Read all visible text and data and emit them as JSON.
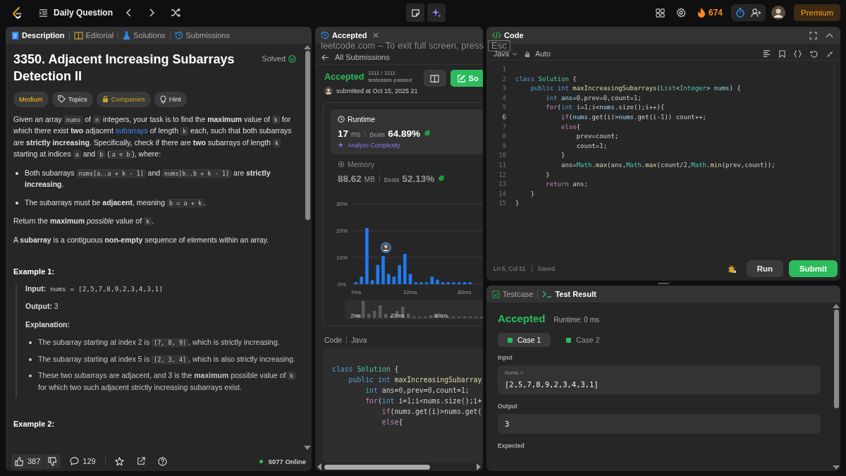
{
  "top_bar": {
    "title": "Daily Question",
    "streak": "674",
    "premium": "Premium"
  },
  "fullscreen_notice": {
    "text": "leetcode.com – To exit full screen, press",
    "key": "Esc"
  },
  "description_panel": {
    "tabs": [
      {
        "label": "Description",
        "selected": true
      },
      {
        "label": "Editorial",
        "selected": false
      },
      {
        "label": "Solutions",
        "selected": false
      },
      {
        "label": "Submissions",
        "selected": false
      }
    ],
    "title": "3350. Adjacent Increasing Subarrays Detection II",
    "status": "Solved",
    "tags": [
      {
        "label": "Medium",
        "kind": "difficulty"
      },
      {
        "label": "Topics",
        "kind": "topics"
      },
      {
        "label": "Companies",
        "kind": "companies"
      },
      {
        "label": "Hint",
        "kind": "hint"
      }
    ],
    "content": [
      {
        "kind": "para",
        "segments": [
          {
            "kind": "t",
            "text": "Given an array "
          },
          {
            "kind": "c",
            "text": "nums"
          },
          {
            "kind": "t",
            "text": " of "
          },
          {
            "kind": "c",
            "text": "n"
          },
          {
            "kind": "t",
            "text": " integers, your task is to find the "
          },
          {
            "kind": "b",
            "text": "maximum"
          },
          {
            "kind": "t",
            "text": " value of "
          },
          {
            "kind": "c",
            "text": "k"
          },
          {
            "kind": "t",
            "text": " for which there exist "
          },
          {
            "kind": "b",
            "text": "two"
          },
          {
            "kind": "t",
            "text": " adjacent "
          },
          {
            "kind": "a",
            "text": "subarrays"
          },
          {
            "kind": "t",
            "text": " of length "
          },
          {
            "kind": "c",
            "text": "k"
          },
          {
            "kind": "t",
            "text": " each, such that both subarrays are "
          },
          {
            "kind": "b",
            "text": "strictly increasing"
          },
          {
            "kind": "t",
            "text": ". Specifically, check if there are "
          },
          {
            "kind": "b",
            "text": "two"
          },
          {
            "kind": "t",
            "text": " subarrays of length "
          },
          {
            "kind": "c",
            "text": "k"
          },
          {
            "kind": "t",
            "text": " starting at indices "
          },
          {
            "kind": "c",
            "text": "a"
          },
          {
            "kind": "t",
            "text": " and "
          },
          {
            "kind": "c",
            "text": "b"
          },
          {
            "kind": "t",
            "text": " ("
          },
          {
            "kind": "c",
            "text": "a < b"
          },
          {
            "kind": "t",
            "text": "), where:"
          }
        ]
      },
      {
        "kind": "bullet",
        "segments": [
          {
            "kind": "t",
            "text": "Both subarrays "
          },
          {
            "kind": "c",
            "text": "nums[a..a + k - 1]"
          },
          {
            "kind": "t",
            "text": " and "
          },
          {
            "kind": "c",
            "text": "nums[b..b + k - 1]"
          },
          {
            "kind": "t",
            "text": " are "
          },
          {
            "kind": "b",
            "text": "strictly increasing"
          },
          {
            "kind": "t",
            "text": "."
          }
        ]
      },
      {
        "kind": "bullet",
        "segments": [
          {
            "kind": "t",
            "text": "The subarrays must be "
          },
          {
            "kind": "b",
            "text": "adjacent"
          },
          {
            "kind": "t",
            "text": ", meaning "
          },
          {
            "kind": "c",
            "text": "b = a + k"
          },
          {
            "kind": "t",
            "text": "."
          }
        ]
      },
      {
        "kind": "para",
        "segments": [
          {
            "kind": "t",
            "text": "Return the "
          },
          {
            "kind": "b",
            "text": "maximum"
          },
          {
            "kind": "i",
            "text": " possible"
          },
          {
            "kind": "t",
            "text": " value of "
          },
          {
            "kind": "c",
            "text": "k"
          },
          {
            "kind": "t",
            "text": "."
          }
        ]
      },
      {
        "kind": "para",
        "segments": [
          {
            "kind": "t",
            "text": "A "
          },
          {
            "kind": "b",
            "text": "subarray"
          },
          {
            "kind": "t",
            "text": " is a contiguous "
          },
          {
            "kind": "b",
            "text": "non-empty"
          },
          {
            "kind": "t",
            "text": " sequence of elements within an array."
          }
        ]
      },
      {
        "kind": "heading",
        "text": "Example 1:"
      },
      {
        "kind": "example",
        "items": [
          {
            "kind": "line",
            "segments": [
              {
                "kind": "b",
                "text": "Input:"
              },
              {
                "kind": "m",
                "text": " nums = [2,5,7,8,9,2,3,4,3,1]"
              }
            ]
          },
          {
            "kind": "line",
            "segments": [
              {
                "kind": "b",
                "text": "Output:"
              },
              {
                "kind": "t",
                "text": " 3"
              }
            ]
          },
          {
            "kind": "line",
            "segments": [
              {
                "kind": "b",
                "text": "Explanation:"
              }
            ]
          },
          {
            "kind": "bullet",
            "segments": [
              {
                "kind": "t",
                "text": "The subarray starting at index 2 is "
              },
              {
                "kind": "c",
                "text": "[7, 8, 9]"
              },
              {
                "kind": "t",
                "text": ", which is strictly increasing."
              }
            ]
          },
          {
            "kind": "bullet",
            "segments": [
              {
                "kind": "t",
                "text": "The subarray starting at index 5 is "
              },
              {
                "kind": "c",
                "text": "[2, 3, 4]"
              },
              {
                "kind": "t",
                "text": ", which is also strictly increasing."
              }
            ]
          },
          {
            "kind": "bullet",
            "segments": [
              {
                "kind": "t",
                "text": "These two subarrays are adjacent, and 3 is the "
              },
              {
                "kind": "b",
                "text": "maximum"
              },
              {
                "kind": "t",
                "text": " possible value of "
              },
              {
                "kind": "c",
                "text": "k"
              },
              {
                "kind": "t",
                "text": " for which two such adjacent strictly increasing subarrays exist."
              }
            ]
          }
        ]
      },
      {
        "kind": "heading",
        "text": "Example 2:"
      }
    ],
    "footer": {
      "likes": "387",
      "comments": "129",
      "online": "5077 Online"
    }
  },
  "submission_panel": {
    "tab": {
      "label": "Accepted",
      "selected": true
    },
    "back": "All Submissions",
    "verdict": "Accepted",
    "passed": "1111 / 1111",
    "passed_caption": "testcases passed",
    "submitted": "submitted at Oct 15, 2025 21",
    "solution_button": "So",
    "metrics": [
      {
        "kind": "runtime",
        "label": "Runtime",
        "value": "17",
        "unit": "ms",
        "beats_label": "Beats",
        "beats": "64.89%",
        "analyze": "Analyze Complexity",
        "selected": true
      },
      {
        "kind": "memory",
        "label": "Memory",
        "value": "88.62",
        "unit": "MB",
        "beats_label": "Beats",
        "beats": "52.13%",
        "selected": false
      }
    ],
    "chart_data": {
      "type": "bar",
      "categories": [
        "7ms",
        null,
        null,
        null,
        null,
        null,
        null,
        null,
        null,
        null,
        "22ms",
        null,
        null,
        null,
        null,
        null,
        null,
        null,
        null,
        null,
        "80ms",
        null
      ],
      "series": [
        {
          "color": "#1e7cf2",
          "values": [
            0.7,
            2.8,
            21,
            1.5,
            7.2,
            10.5,
            3.8,
            2.8,
            7.2,
            11.3,
            3.8,
            0.7,
            0.7,
            0.7,
            2.8,
            1.7,
            0.7,
            0.7,
            0.7,
            0.7,
            0.7,
            0.7
          ]
        }
      ],
      "ylim": [
        0,
        30
      ],
      "yticks": [
        {
          "value": 0,
          "label": "0%"
        },
        {
          "value": 10,
          "label": "10%"
        },
        {
          "value": 20,
          "label": "20%"
        },
        {
          "value": 30,
          "label": "30%"
        }
      ]
    },
    "overview_labels": [
      "7ms",
      "22ms",
      "80ms"
    ],
    "code_label": "Code",
    "language": "Java",
    "code_lines": [
      [
        {
          "kind": "kw",
          "text": "class "
        },
        {
          "kind": "type",
          "text": "Solution"
        },
        {
          "kind": "p",
          "text": " {"
        }
      ],
      [
        {
          "kind": "kw",
          "text": "    public int "
        },
        {
          "kind": "fn",
          "text": "maxIncreasingSubarray"
        }
      ],
      [
        {
          "kind": "kw",
          "text": "        int "
        },
        {
          "kind": "p",
          "text": "ans="
        },
        {
          "kind": "num",
          "text": "0"
        },
        {
          "kind": "p",
          "text": ",prev="
        },
        {
          "kind": "num",
          "text": "0"
        },
        {
          "kind": "p",
          "text": ",count="
        },
        {
          "kind": "num",
          "text": "1"
        },
        {
          "kind": "p",
          "text": ";"
        }
      ],
      [
        {
          "kind": "ctl",
          "text": "        for"
        },
        {
          "kind": "p",
          "text": "("
        },
        {
          "kind": "kw",
          "text": "int "
        },
        {
          "kind": "p",
          "text": "i="
        },
        {
          "kind": "num",
          "text": "1"
        },
        {
          "kind": "p",
          "text": ";i<nums.size();i+"
        }
      ],
      [
        {
          "kind": "ctl",
          "text": "            if"
        },
        {
          "kind": "p",
          "text": "(nums.get(i)>nums.get("
        }
      ],
      [
        {
          "kind": "ctl",
          "text": "            else"
        },
        {
          "kind": "p",
          "text": "{"
        }
      ]
    ]
  },
  "editor": {
    "title": "Code",
    "language": "Java",
    "mode": "Auto",
    "lines": [
      {
        "n": "1",
        "active": false
      },
      {
        "n": "2",
        "active": false,
        "tokens": [
          {
            "kind": "kw",
            "text": "class "
          },
          {
            "kind": "type",
            "text": "Solution"
          },
          {
            "kind": "p",
            "text": " {"
          }
        ]
      },
      {
        "n": "3",
        "active": false,
        "tokens": [
          {
            "kind": "kw",
            "text": "    public int "
          },
          {
            "kind": "fn",
            "text": "maxIncreasingSubarrays"
          },
          {
            "kind": "p",
            "text": "("
          },
          {
            "kind": "type",
            "text": "List"
          },
          {
            "kind": "p",
            "text": "<"
          },
          {
            "kind": "type",
            "text": "Integer"
          },
          {
            "kind": "p",
            "text": "> "
          },
          {
            "kind": "var",
            "text": "nums"
          },
          {
            "kind": "p",
            "text": ") {"
          }
        ]
      },
      {
        "n": "4",
        "active": false,
        "tokens": [
          {
            "kind": "kw",
            "text": "        int "
          },
          {
            "kind": "var",
            "text": "ans"
          },
          {
            "kind": "p",
            "text": "="
          },
          {
            "kind": "num",
            "text": "0"
          },
          {
            "kind": "p",
            "text": ",prev="
          },
          {
            "kind": "num",
            "text": "0"
          },
          {
            "kind": "p",
            "text": ",count="
          },
          {
            "kind": "num",
            "text": "1"
          },
          {
            "kind": "p",
            "text": ";"
          }
        ]
      },
      {
        "n": "5",
        "active": false,
        "tokens": [
          {
            "kind": "ctl",
            "text": "        for"
          },
          {
            "kind": "p",
            "text": "("
          },
          {
            "kind": "kw",
            "text": "int "
          },
          {
            "kind": "p",
            "text": "i="
          },
          {
            "kind": "num",
            "text": "1"
          },
          {
            "kind": "p",
            "text": ";i<"
          },
          {
            "kind": "var",
            "text": "nums"
          },
          {
            "kind": "p",
            "text": ".size();i++){"
          }
        ]
      },
      {
        "n": "6",
        "active": true,
        "tokens": [
          {
            "kind": "ctl",
            "text": "            if"
          },
          {
            "kind": "p",
            "text": "("
          },
          {
            "kind": "var",
            "text": "nums"
          },
          {
            "kind": "p",
            "text": ".get(i)>"
          },
          {
            "kind": "var",
            "text": "nums"
          },
          {
            "kind": "p",
            "text": ".get(i-"
          },
          {
            "kind": "num",
            "text": "1"
          },
          {
            "kind": "p",
            "text": ")) count++;"
          }
        ]
      },
      {
        "n": "7",
        "active": false,
        "tokens": [
          {
            "kind": "ctl",
            "text": "            else"
          },
          {
            "kind": "p",
            "text": "{"
          }
        ]
      },
      {
        "n": "8",
        "active": false,
        "tokens": [
          {
            "kind": "p",
            "text": "                prev=count;"
          }
        ]
      },
      {
        "n": "9",
        "active": false,
        "tokens": [
          {
            "kind": "p",
            "text": "                count="
          },
          {
            "kind": "num",
            "text": "1"
          },
          {
            "kind": "p",
            "text": ";"
          }
        ]
      },
      {
        "n": "10",
        "active": false,
        "tokens": [
          {
            "kind": "p",
            "text": "            }"
          }
        ]
      },
      {
        "n": "11",
        "active": false,
        "tokens": [
          {
            "kind": "p",
            "text": "            ans="
          },
          {
            "kind": "type",
            "text": "Math"
          },
          {
            "kind": "p",
            "text": "."
          },
          {
            "kind": "fn",
            "text": "max"
          },
          {
            "kind": "p",
            "text": "(ans,"
          },
          {
            "kind": "type",
            "text": "Math"
          },
          {
            "kind": "p",
            "text": "."
          },
          {
            "kind": "fn",
            "text": "max"
          },
          {
            "kind": "p",
            "text": "(count/"
          },
          {
            "kind": "num",
            "text": "2"
          },
          {
            "kind": "p",
            "text": ","
          },
          {
            "kind": "type",
            "text": "Math"
          },
          {
            "kind": "p",
            "text": "."
          },
          {
            "kind": "fn",
            "text": "min"
          },
          {
            "kind": "p",
            "text": "(prev,count));"
          }
        ]
      },
      {
        "n": "12",
        "active": false,
        "tokens": [
          {
            "kind": "p",
            "text": "        }"
          }
        ]
      },
      {
        "n": "13",
        "active": false,
        "tokens": [
          {
            "kind": "ctl",
            "text": "        return"
          },
          {
            "kind": "p",
            "text": " ans;"
          }
        ]
      },
      {
        "n": "14",
        "active": false,
        "tokens": [
          {
            "kind": "p",
            "text": "    }"
          }
        ]
      },
      {
        "n": "15",
        "active": false,
        "tokens": [
          {
            "kind": "p",
            "text": "}"
          }
        ]
      }
    ],
    "cursor": "Ln 6, Col 51",
    "saved": "Saved",
    "run": "Run",
    "submit": "Submit"
  },
  "result_panel": {
    "tabs": [
      {
        "label": "Testcase",
        "selected": false
      },
      {
        "label": "Test Result",
        "selected": true
      }
    ],
    "verdict": "Accepted",
    "runtime": "Runtime: 0 ms",
    "cases": [
      {
        "label": "Case 1",
        "selected": true
      },
      {
        "label": "Case 2",
        "selected": false
      }
    ],
    "input_label": "Input",
    "param": "nums =",
    "input_value": "[2,5,7,8,9,2,3,4,3,1]",
    "output_label": "Output",
    "output_value": "3",
    "expected_label": "Expected"
  }
}
